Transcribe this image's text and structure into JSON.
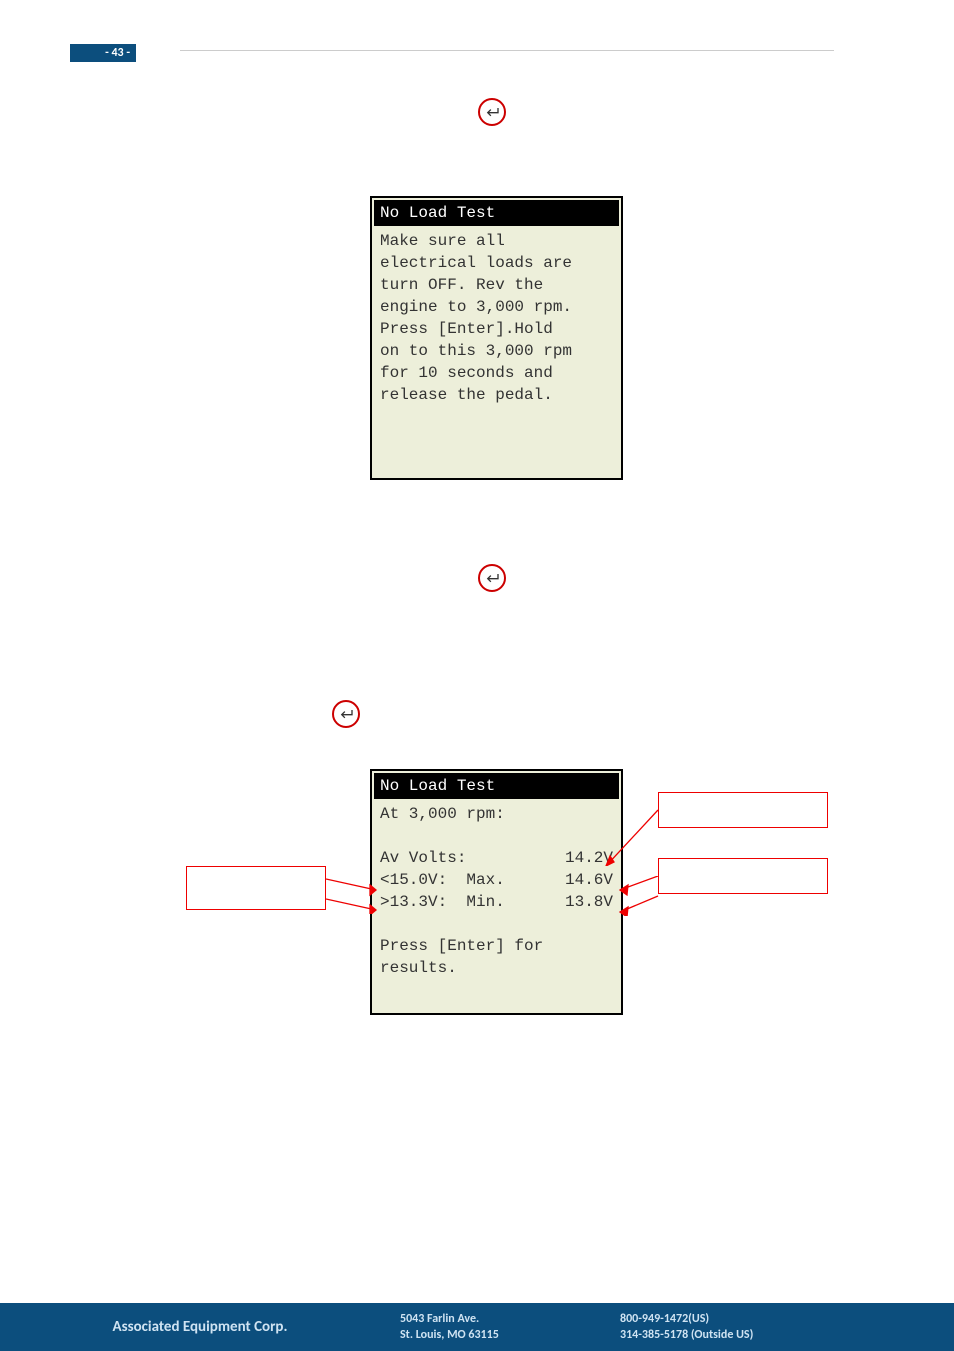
{
  "page_number": "- 43 -",
  "screen1": {
    "title": "No Load Test",
    "lines": [
      "Make sure all",
      "electrical loads are",
      "turn OFF. Rev the",
      "engine to 3,000 rpm.",
      "Press [Enter].Hold",
      "on to this 3,000 rpm",
      "for 10 seconds and",
      "release the pedal."
    ]
  },
  "screen2": {
    "title": "No Load Test",
    "header": "At 3,000 rpm:",
    "rows": [
      {
        "l": "Av Volts:",
        "r": "14.2V"
      },
      {
        "l": "<15.0V:  Max.",
        "r": "14.6V"
      },
      {
        "l": ">13.3V:  Min.",
        "r": "13.8V"
      }
    ],
    "footer_lines": [
      "Press [Enter] for",
      "results."
    ]
  },
  "footer": {
    "company": "Associated Equipment Corp.",
    "addr1": "5043 Farlin Ave.",
    "addr2": "St. Louis, MO 63115",
    "phone1": "800-949-1472(US)",
    "phone2": "314-385-5178 (Outside US)"
  }
}
